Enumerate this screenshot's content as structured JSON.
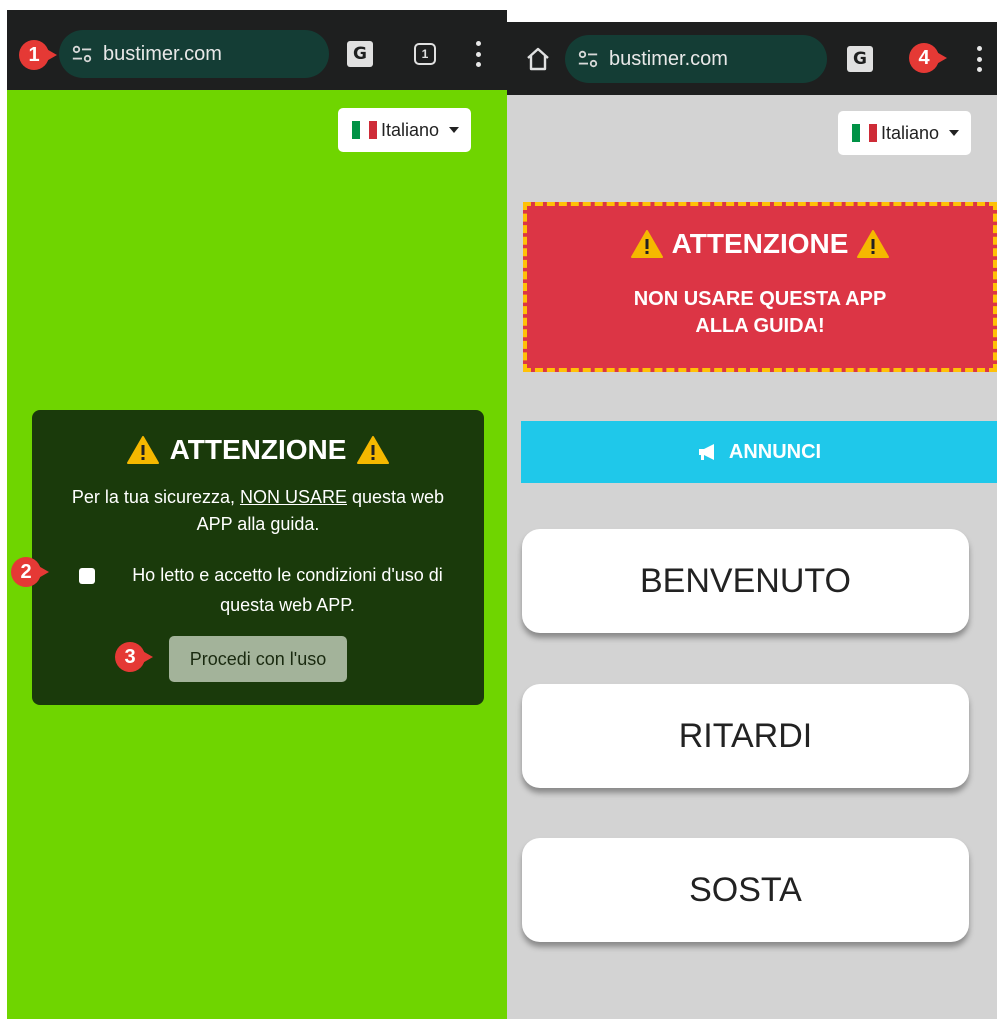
{
  "left_screen": {
    "url": "bustimer.com",
    "tab_count": "1",
    "language": "Italiano",
    "modal": {
      "title": "ATTENZIONE",
      "text_before": "Per la tua sicurezza, ",
      "text_underlined": "NON USARE",
      "text_after": " questa web APP alla guida.",
      "checkbox_label": "Ho letto e accetto le condizioni d'uso di questa web APP.",
      "proceed_label": "Procedi con l'uso"
    }
  },
  "right_screen": {
    "url": "bustimer.com",
    "language": "Italiano",
    "alert": {
      "title": "ATTENZIONE",
      "line1": "NON USARE QUESTA APP",
      "line2": "ALLA GUIDA!"
    },
    "announcements_label": "ANNUNCI",
    "buttons": [
      "BENVENUTO",
      "RITARDI",
      "SOSTA"
    ]
  },
  "markers": [
    "1",
    "2",
    "3",
    "4"
  ],
  "colors": {
    "left_background": "#6fd500",
    "right_background": "#d3d3d3",
    "modal_background": "#1a3a0b",
    "alert_background": "#dc3545",
    "alert_border": "#ffc107",
    "announce_background": "#1fc8ea",
    "marker": "#e53935"
  },
  "icons": [
    "site-info-icon",
    "translate-icon",
    "tabs-icon",
    "kebab-menu-icon",
    "home-icon",
    "warning-icon",
    "megaphone-icon",
    "italy-flag-icon",
    "caret-down-icon"
  ]
}
